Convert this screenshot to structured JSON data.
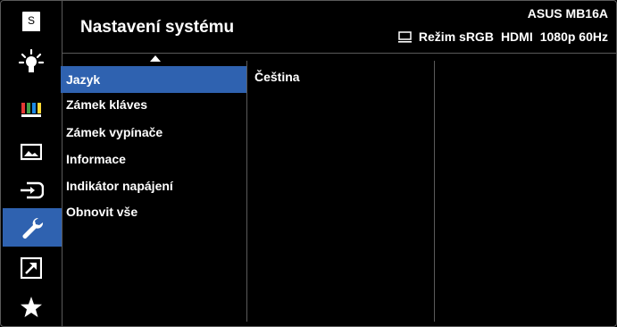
{
  "header": {
    "title": "Nastavení systému",
    "model": "ASUS MB16A",
    "mode": "Režim sRGB",
    "input": "HDMI",
    "resolution": "1080p 60Hz"
  },
  "iconbar": {
    "items": [
      {
        "icon": "splendid-s-icon"
      },
      {
        "icon": "blue-light-filter-icon"
      },
      {
        "icon": "color-icon"
      },
      {
        "icon": "image-icon"
      },
      {
        "icon": "input-select-icon"
      },
      {
        "icon": "system-setup-icon",
        "active": true
      },
      {
        "icon": "shortcut-icon"
      },
      {
        "icon": "myfavorite-star-icon"
      }
    ]
  },
  "menu": {
    "items": [
      {
        "label": "Jazyk",
        "active": true
      },
      {
        "label": "Zámek kláves"
      },
      {
        "label": "Zámek vypínače"
      },
      {
        "label": "Informace"
      },
      {
        "label": "Indikátor napájení"
      },
      {
        "label": "Obnovit vše"
      }
    ]
  },
  "submenu": {
    "value": "Čeština"
  },
  "colors": {
    "accent": "#2f62b0",
    "background": "#000000",
    "divider": "#5a5a5a"
  }
}
